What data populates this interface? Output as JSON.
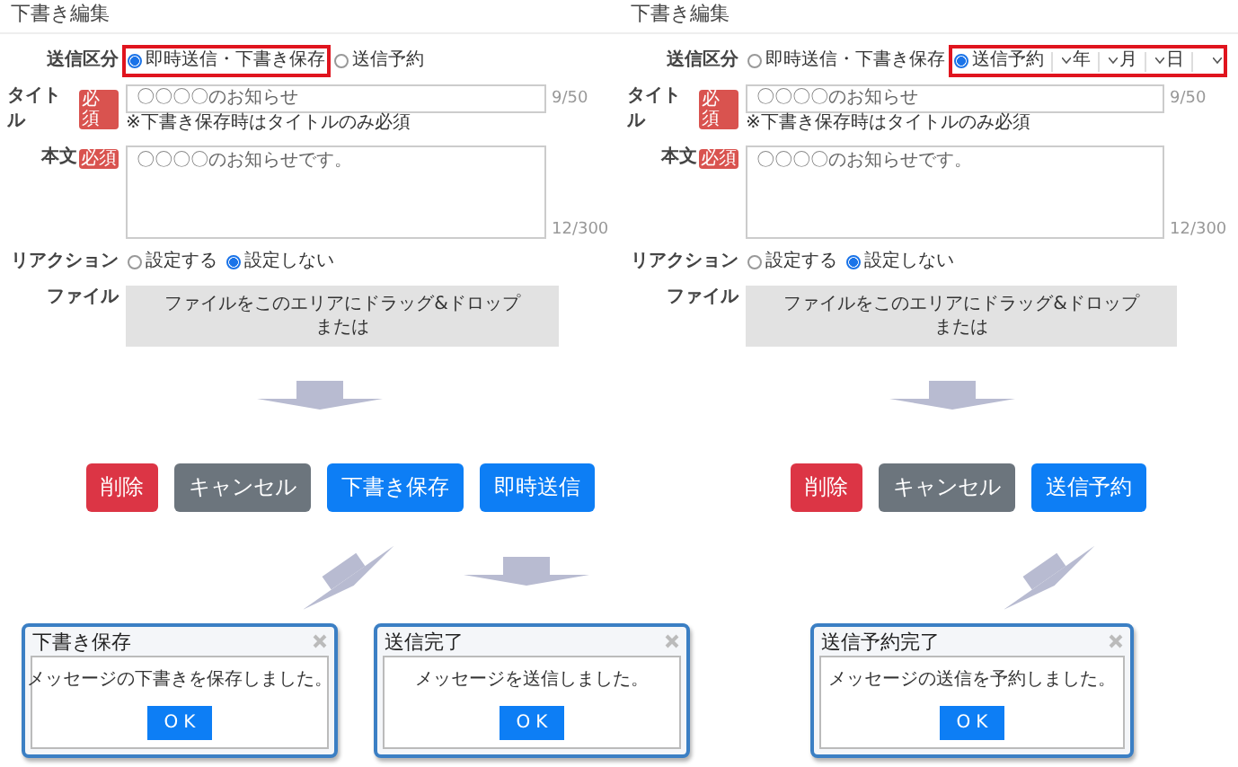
{
  "panels": [
    {
      "title": "下書き編集",
      "send_type": {
        "label": "送信区分",
        "options": [
          {
            "label": "即時送信・下書き保存",
            "selected": true,
            "highlighted": true
          },
          {
            "label": "送信予約",
            "selected": false,
            "highlighted": false
          }
        ]
      },
      "subject": {
        "label": "タイトル",
        "badge": "必須",
        "value": "〇〇〇〇のお知らせ",
        "count": "9/50",
        "note": "※下書き保存時はタイトルのみ必須"
      },
      "body": {
        "label": "本文",
        "badge": "必須",
        "value": "〇〇〇〇のお知らせです。",
        "count": "12/300"
      },
      "reaction": {
        "label": "リアクション",
        "options": [
          {
            "label": "設定する",
            "selected": false
          },
          {
            "label": "設定しない",
            "selected": true
          }
        ]
      },
      "file": {
        "label": "ファイル",
        "drop_text": "ファイルをこのエリアにドラッグ&ドロップ",
        "alt_text": "または"
      },
      "buttons": [
        {
          "label": "削除",
          "kind": "danger"
        },
        {
          "label": "キャンセル",
          "kind": "secondary"
        },
        {
          "label": "下書き保存",
          "kind": "primary"
        },
        {
          "label": "即時送信",
          "kind": "primary"
        }
      ]
    },
    {
      "title": "下書き編集",
      "send_type": {
        "label": "送信区分",
        "options": [
          {
            "label": "即時送信・下書き保存",
            "selected": false,
            "highlighted": false
          },
          {
            "label": "送信予約",
            "selected": true,
            "highlighted": true,
            "date_selects": [
              {
                "unit": "年"
              },
              {
                "unit": "月"
              },
              {
                "unit": "日"
              },
              {
                "kind": "time"
              }
            ]
          }
        ]
      },
      "subject": {
        "label": "タイトル",
        "badge": "必須",
        "value": "〇〇〇〇のお知らせ",
        "count": "9/50",
        "note": "※下書き保存時はタイトルのみ必須"
      },
      "body": {
        "label": "本文",
        "badge": "必須",
        "value": "〇〇〇〇のお知らせです。",
        "count": "12/300"
      },
      "reaction": {
        "label": "リアクション",
        "options": [
          {
            "label": "設定する",
            "selected": false
          },
          {
            "label": "設定しない",
            "selected": true
          }
        ]
      },
      "file": {
        "label": "ファイル",
        "drop_text": "ファイルをこのエリアにドラッグ&ドロップ",
        "alt_text": "または"
      },
      "buttons": [
        {
          "label": "削除",
          "kind": "danger"
        },
        {
          "label": "キャンセル",
          "kind": "secondary"
        },
        {
          "label": "送信予約",
          "kind": "primary"
        }
      ]
    }
  ],
  "dialogs": [
    {
      "title": "下書き保存",
      "message": "メッセージの下書きを保存しました。",
      "ok": "OK"
    },
    {
      "title": "送信完了",
      "message": "メッセージを送信しました。",
      "ok": "OK"
    },
    {
      "title": "送信予約完了",
      "message": "メッセージの送信を予約しました。",
      "ok": "OK"
    }
  ]
}
